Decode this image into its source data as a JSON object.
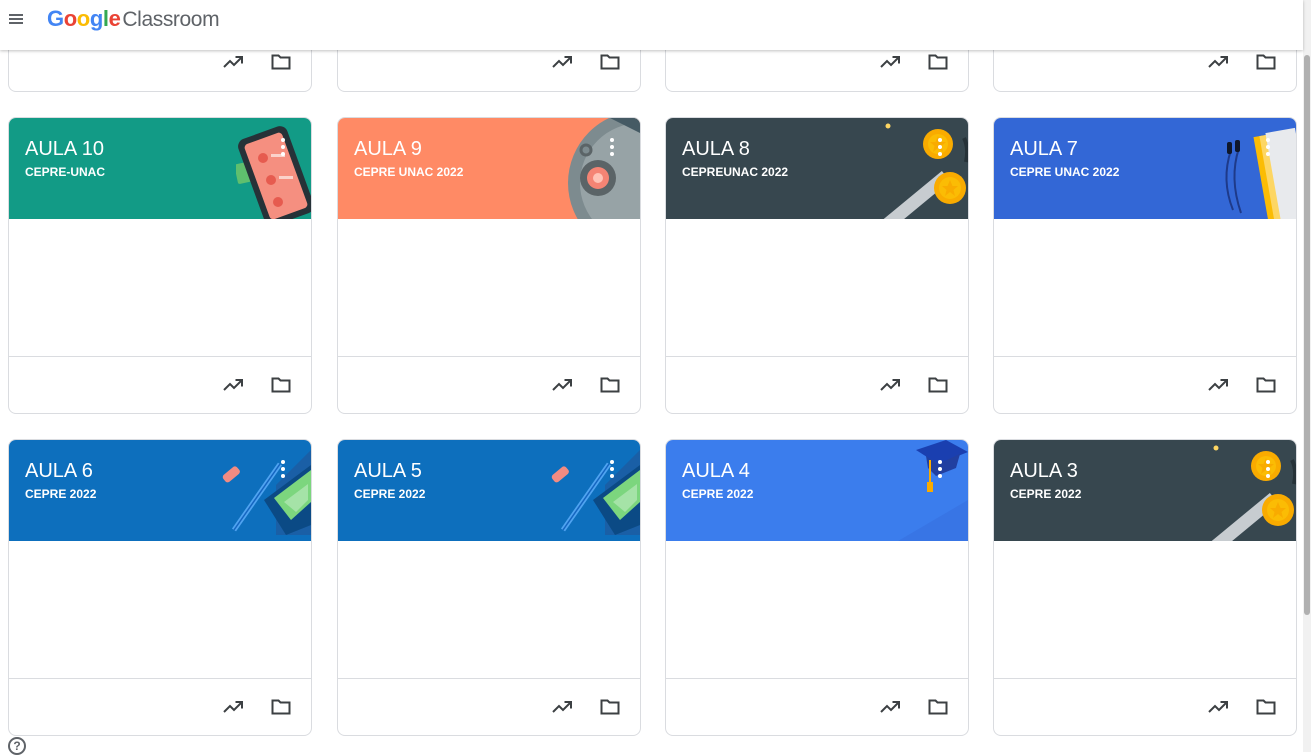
{
  "app": {
    "logo_google": [
      "G",
      "o",
      "o",
      "g",
      "l",
      "e"
    ],
    "logo_product": "Classroom",
    "brand_colors": [
      "#4285f4",
      "#ea4335",
      "#fbbc04",
      "#4285f4",
      "#34a853",
      "#ea4335"
    ]
  },
  "help_label": "?",
  "classes": [
    {
      "title": "",
      "subtitle": "",
      "color": "",
      "theme": "none"
    },
    {
      "title": "",
      "subtitle": "",
      "color": "",
      "theme": "none"
    },
    {
      "title": "",
      "subtitle": "",
      "color": "",
      "theme": "none"
    },
    {
      "title": "",
      "subtitle": "",
      "color": "",
      "theme": "none"
    },
    {
      "title": "AULA 10",
      "subtitle": "CEPRE-UNAC",
      "color": "#129b86",
      "theme": "phone"
    },
    {
      "title": "AULA 9",
      "subtitle": "CEPRE UNAC 2022",
      "color": "#ff8a65",
      "theme": "science"
    },
    {
      "title": "AULA 8",
      "subtitle": "CEPREUNAC 2022",
      "color": "#37474f",
      "theme": "medals"
    },
    {
      "title": "AULA 7",
      "subtitle": "CEPRE UNAC 2022",
      "color": "#3367d6",
      "theme": "books"
    },
    {
      "title": "AULA 6",
      "subtitle": "CEPRE 2022",
      "color": "#0d6fbd",
      "theme": "pencil"
    },
    {
      "title": "AULA 5",
      "subtitle": "CEPRE 2022",
      "color": "#0d6fbd",
      "theme": "pencil"
    },
    {
      "title": "AULA 4",
      "subtitle": "CEPRE 2022",
      "color": "#3b7ded",
      "theme": "grad"
    },
    {
      "title": "AULA 3",
      "subtitle": "CEPRE 2022",
      "color": "#37474f",
      "theme": "medals"
    }
  ]
}
